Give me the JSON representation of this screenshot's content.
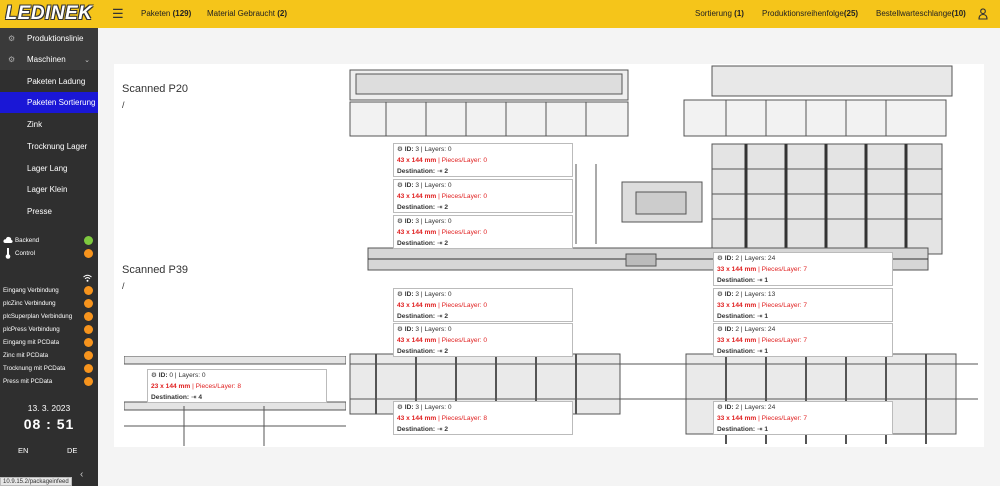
{
  "app": {
    "logo": "LEDINEK"
  },
  "topbar": {
    "left": [
      {
        "label": "Paketen",
        "count": "(129)"
      },
      {
        "label": "Material Gebraucht",
        "count": "(2)"
      }
    ],
    "right": [
      {
        "label": "Sortierung",
        "count": "(1)"
      },
      {
        "label": "Produktionsreihenfolge",
        "count": "(25)"
      },
      {
        "label": "Bestellwarteschlange",
        "count": "(10)"
      }
    ]
  },
  "sidebar": {
    "items": [
      {
        "label": "Produktionslinie",
        "icon": "gear-icon"
      },
      {
        "label": "Maschinen",
        "icon": "gear-icon"
      },
      {
        "label": "Paketen Ladung"
      },
      {
        "label": "Paketen Sortierung"
      },
      {
        "label": "Zink"
      },
      {
        "label": "Trocknung Lager"
      },
      {
        "label": "Lager Lang"
      },
      {
        "label": "Lager Klein"
      },
      {
        "label": "Presse"
      }
    ],
    "status_top": [
      {
        "label": "Backend",
        "color": "#7ec93f"
      },
      {
        "label": "Control",
        "color": "#f7941d"
      }
    ],
    "status": [
      {
        "label": "Eingang Verbindung"
      },
      {
        "label": "plcZinc Verbindung"
      },
      {
        "label": "plcSuperplan Verbindung"
      },
      {
        "label": "plcPress Verbindung"
      },
      {
        "label": "Eingang mit PCData"
      },
      {
        "label": "Zinc mit PCData"
      },
      {
        "label": "Trocknung mit PCData"
      },
      {
        "label": "Press mit PCData"
      }
    ],
    "date": "13. 3. 2023",
    "time": "08 : 51",
    "lang_en": "EN",
    "lang_de": "DE"
  },
  "url_tip": "10.9.15.2/packageinfeed",
  "scanned": [
    {
      "title": "Scanned P20",
      "value": "/"
    },
    {
      "title": "Scanned P39",
      "value": "/"
    }
  ],
  "packages": [
    {
      "id": "3",
      "layers": "0",
      "size": "43 x 144 mm",
      "ppl": "0",
      "dest": "2"
    },
    {
      "id": "3",
      "layers": "0",
      "size": "43 x 144 mm",
      "ppl": "0",
      "dest": "2"
    },
    {
      "id": "3",
      "layers": "0",
      "size": "43 x 144 mm",
      "ppl": "0",
      "dest": "2"
    },
    {
      "id": "2",
      "layers": "24",
      "size": "33 x 144 mm",
      "ppl": "7",
      "dest": "1"
    },
    {
      "id": "3",
      "layers": "0",
      "size": "43 x 144 mm",
      "ppl": "0",
      "dest": "2"
    },
    {
      "id": "2",
      "layers": "13",
      "size": "33 x 144 mm",
      "ppl": "7",
      "dest": "1"
    },
    {
      "id": "3",
      "layers": "0",
      "size": "43 x 144 mm",
      "ppl": "0",
      "dest": "2"
    },
    {
      "id": "2",
      "layers": "24",
      "size": "33 x 144 mm",
      "ppl": "7",
      "dest": "1"
    },
    {
      "id": "0",
      "layers": "0",
      "size": "23 x 144 mm",
      "ppl": "8",
      "dest": "4"
    },
    {
      "id": "3",
      "layers": "0",
      "size": "43 x 144 mm",
      "ppl": "8",
      "dest": "2"
    },
    {
      "id": "2",
      "layers": "24",
      "size": "33 x 144 mm",
      "ppl": "7",
      "dest": "1"
    }
  ],
  "labels": {
    "id": "ID:",
    "layers": "| Layers:",
    "ppl": "| Pieces/Layer:",
    "dest": "Destination:",
    "arrow": "⇥"
  }
}
